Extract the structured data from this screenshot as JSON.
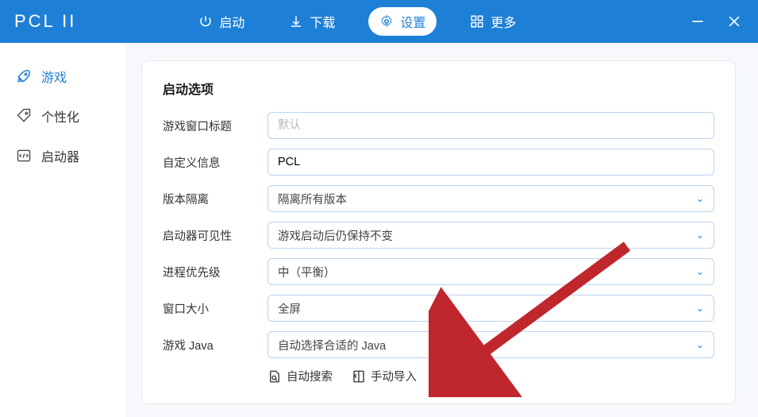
{
  "header": {
    "app_title": "PCL II",
    "nav": {
      "launch": "启动",
      "download": "下载",
      "settings": "设置",
      "more": "更多"
    }
  },
  "sidebar": {
    "game": "游戏",
    "personalize": "个性化",
    "launcher": "启动器"
  },
  "card": {
    "title": "启动选项",
    "rows": {
      "window_title_label": "游戏窗口标题",
      "window_title_placeholder": "默认",
      "custom_info_label": "自定义信息",
      "custom_info_value": "PCL",
      "version_isolation_label": "版本隔离",
      "version_isolation_value": "隔离所有版本",
      "launcher_visibility_label": "启动器可见性",
      "launcher_visibility_value": "游戏启动后仍保持不变",
      "process_priority_label": "进程优先级",
      "process_priority_value": "中（平衡）",
      "window_size_label": "窗口大小",
      "window_size_value": "全屏",
      "game_java_label": "游戏 Java",
      "game_java_value": "自动选择合适的 Java"
    },
    "java_actions": {
      "auto_search": "自动搜索",
      "manual_import": "手动导入"
    }
  }
}
